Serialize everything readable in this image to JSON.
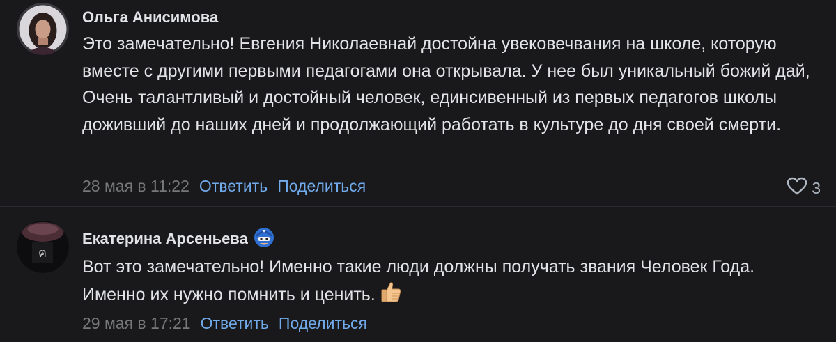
{
  "comments": [
    {
      "author": "Ольга Анисимова",
      "text": "Это замечательно! Евгения Николаевнай достойна увековечвания на школе, которую вместе с другими первыми педагогами она открывала. У нее был уникальный божий дай, Очень талантливый и достойный человек, единсивенный из первых педагогов школы доживший до наших дней и продолжающий работать в культуре до дня своей смерти.",
      "time": "28 мая в 11:22",
      "reply": "Ответить",
      "share": "Поделиться",
      "likes": "3"
    },
    {
      "author": "Екатерина Арсеньева",
      "text": "Вот это замечательно! Именно такие люди должны получать звания Человек Года. Именно их нужно помнить и ценить.",
      "time": "29 мая в 17:21",
      "reply": "Ответить",
      "share": "Поделиться"
    }
  ],
  "colors": {
    "background": "#19191b",
    "text": "#e1e3e6",
    "muted": "#76787a",
    "link": "#71aaeb"
  },
  "icons": {
    "like": "heart-outline-icon",
    "emoji": "thumbs-up-emoji-icon",
    "badge": "superhero-badge-icon"
  }
}
